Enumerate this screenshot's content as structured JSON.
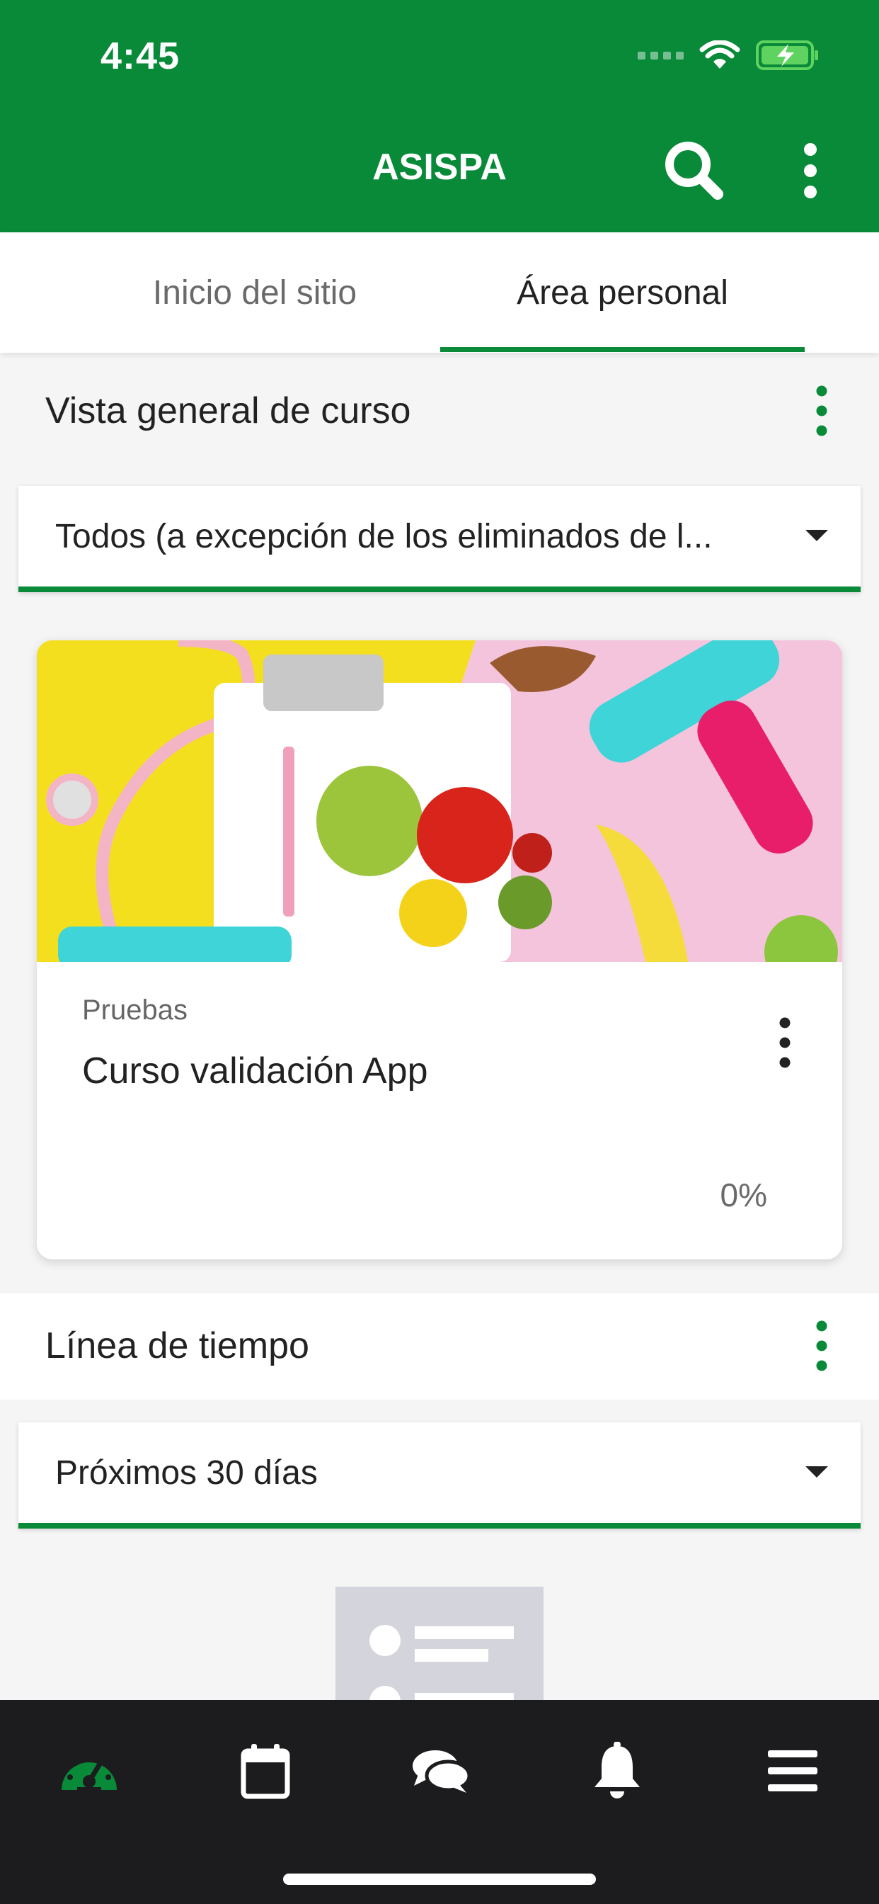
{
  "status_bar": {
    "time": "4:45"
  },
  "app_bar": {
    "title": "ASISPA"
  },
  "tabs": [
    {
      "label": "Inicio del sitio",
      "active": false
    },
    {
      "label": "Área personal",
      "active": true
    }
  ],
  "course_overview": {
    "title": "Vista general de curso",
    "filter": "Todos (a excepción de los eliminados de l...",
    "courses": [
      {
        "category": "Pruebas",
        "name": "Curso validación App",
        "progress": "0%"
      }
    ]
  },
  "timeline": {
    "title": "Línea de tiempo",
    "filter": "Próximos 30 días"
  },
  "bottom_nav": [
    {
      "icon": "dashboard-icon",
      "active": true
    },
    {
      "icon": "calendar-icon",
      "active": false
    },
    {
      "icon": "messages-icon",
      "active": false
    },
    {
      "icon": "notifications-icon",
      "active": false
    },
    {
      "icon": "menu-icon",
      "active": false
    }
  ],
  "colors": {
    "brand_green": "#088a39",
    "bottom_bar": "#1c1c1e",
    "background": "#f5f5f5"
  }
}
